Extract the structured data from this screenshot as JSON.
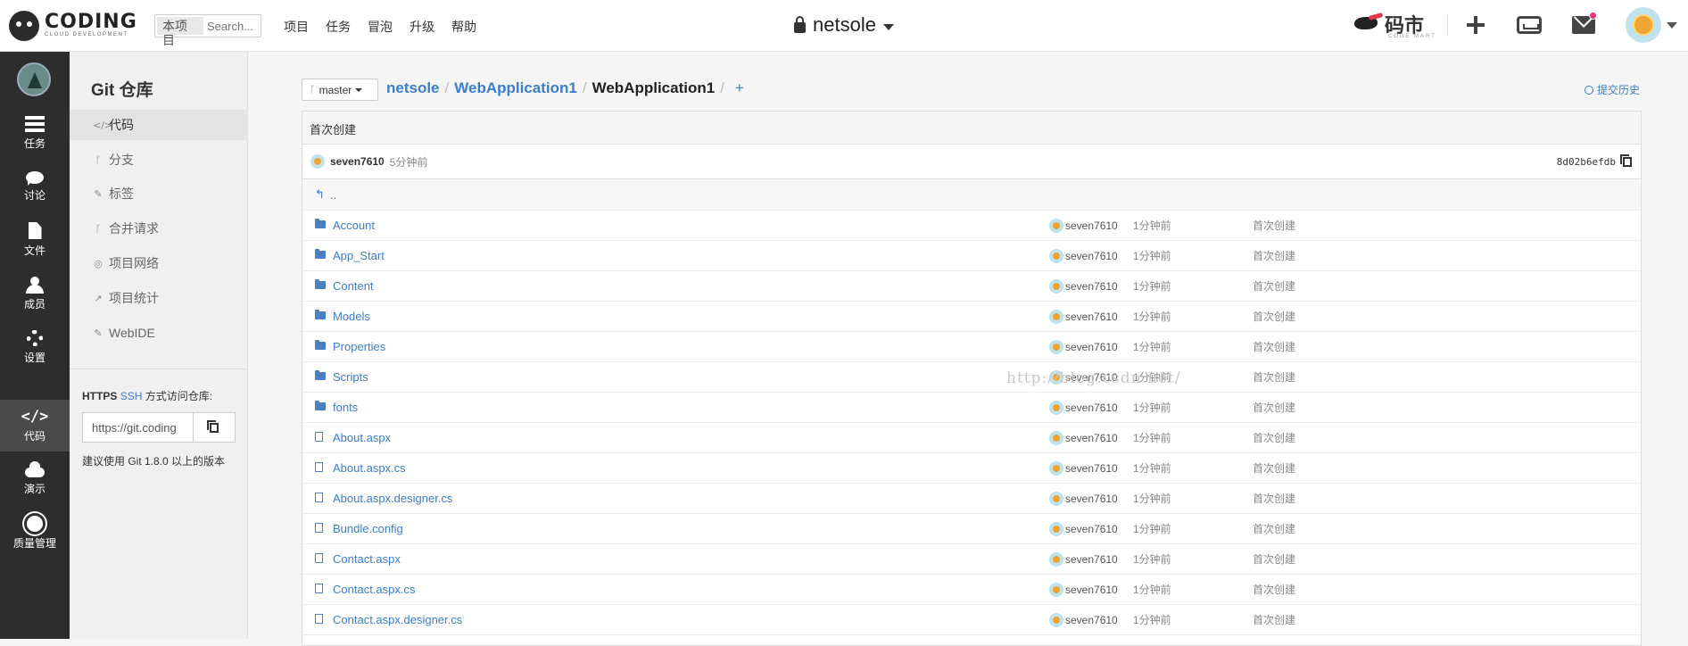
{
  "topbar": {
    "logo_text": "CODING",
    "logo_sub": "CLOUD DEVELOPMENT",
    "scope_tag": "本项目",
    "search_placeholder": "Search...",
    "nav": [
      "项目",
      "任务",
      "冒泡",
      "升级",
      "帮助"
    ],
    "project_name": "netsole",
    "codemart_text": "码市",
    "codemart_sub": "CODE MART"
  },
  "leftbar": {
    "items": [
      {
        "label": "任务",
        "icon": "tasks-icon"
      },
      {
        "label": "讨论",
        "icon": "chat-icon"
      },
      {
        "label": "文件",
        "icon": "file-icon"
      },
      {
        "label": "成员",
        "icon": "members-icon"
      },
      {
        "label": "设置",
        "icon": "gear-icon"
      },
      {
        "label": "代码",
        "icon": "code-icon",
        "active": true
      },
      {
        "label": "演示",
        "icon": "cloud-icon"
      },
      {
        "label": "质量管理",
        "icon": "quality-icon"
      }
    ]
  },
  "gitpanel": {
    "title": "Git 仓库",
    "items": [
      {
        "label": "代码",
        "glyph": "</>",
        "active": true
      },
      {
        "label": "分支",
        "glyph": "ᚴ"
      },
      {
        "label": "标签",
        "glyph": "✎"
      },
      {
        "label": "合并请求",
        "glyph": "ᚴ"
      },
      {
        "label": "项目网络",
        "glyph": "◎"
      },
      {
        "label": "项目统计",
        "glyph": "↗"
      },
      {
        "label": "WebIDE",
        "glyph": "✎"
      }
    ],
    "access_https": "HTTPS",
    "access_ssh": "SSH",
    "access_text": "方式访问仓库:",
    "clone_url": "https://git.coding",
    "hint": "建议使用 Git 1.8.0 以上的版本"
  },
  "main": {
    "branch": "master",
    "breadcrumb": {
      "owner": "netsole",
      "repo": "WebApplication1",
      "current": "WebApplication1",
      "add": "+"
    },
    "history_label": "提交历史",
    "commit": {
      "message": "首次创建",
      "author": "seven7610",
      "time": "5分钟前",
      "hash": "8d02b6efdb"
    },
    "parent_dir": "..",
    "files": [
      {
        "name": "Account",
        "type": "folder",
        "time": "1分钟前",
        "author": "seven7610",
        "message": "首次创建"
      },
      {
        "name": "App_Start",
        "type": "folder",
        "time": "1分钟前",
        "author": "seven7610",
        "message": "首次创建"
      },
      {
        "name": "Content",
        "type": "folder",
        "time": "1分钟前",
        "author": "seven7610",
        "message": "首次创建"
      },
      {
        "name": "Models",
        "type": "folder",
        "time": "1分钟前",
        "author": "seven7610",
        "message": "首次创建"
      },
      {
        "name": "Properties",
        "type": "folder",
        "time": "1分钟前",
        "author": "seven7610",
        "message": "首次创建"
      },
      {
        "name": "Scripts",
        "type": "folder",
        "time": "1分钟前",
        "author": "seven7610",
        "message": "首次创建"
      },
      {
        "name": "fonts",
        "type": "folder",
        "time": "1分钟前",
        "author": "seven7610",
        "message": "首次创建"
      },
      {
        "name": "About.aspx",
        "type": "file",
        "time": "1分钟前",
        "author": "seven7610",
        "message": "首次创建"
      },
      {
        "name": "About.aspx.cs",
        "type": "file",
        "time": "1分钟前",
        "author": "seven7610",
        "message": "首次创建"
      },
      {
        "name": "About.aspx.designer.cs",
        "type": "file",
        "time": "1分钟前",
        "author": "seven7610",
        "message": "首次创建"
      },
      {
        "name": "Bundle.config",
        "type": "file",
        "time": "1分钟前",
        "author": "seven7610",
        "message": "首次创建"
      },
      {
        "name": "Contact.aspx",
        "type": "file",
        "time": "1分钟前",
        "author": "seven7610",
        "message": "首次创建"
      },
      {
        "name": "Contact.aspx.cs",
        "type": "file",
        "time": "1分钟前",
        "author": "seven7610",
        "message": "首次创建"
      },
      {
        "name": "Contact.aspx.designer.cs",
        "type": "file",
        "time": "1分钟前",
        "author": "seven7610",
        "message": "首次创建"
      }
    ]
  },
  "watermark": "http://blog.csdn.net/",
  "colors": {
    "link": "#3b7ecb",
    "sidebar": "#2d2d2d",
    "notification": "#e0367b"
  }
}
